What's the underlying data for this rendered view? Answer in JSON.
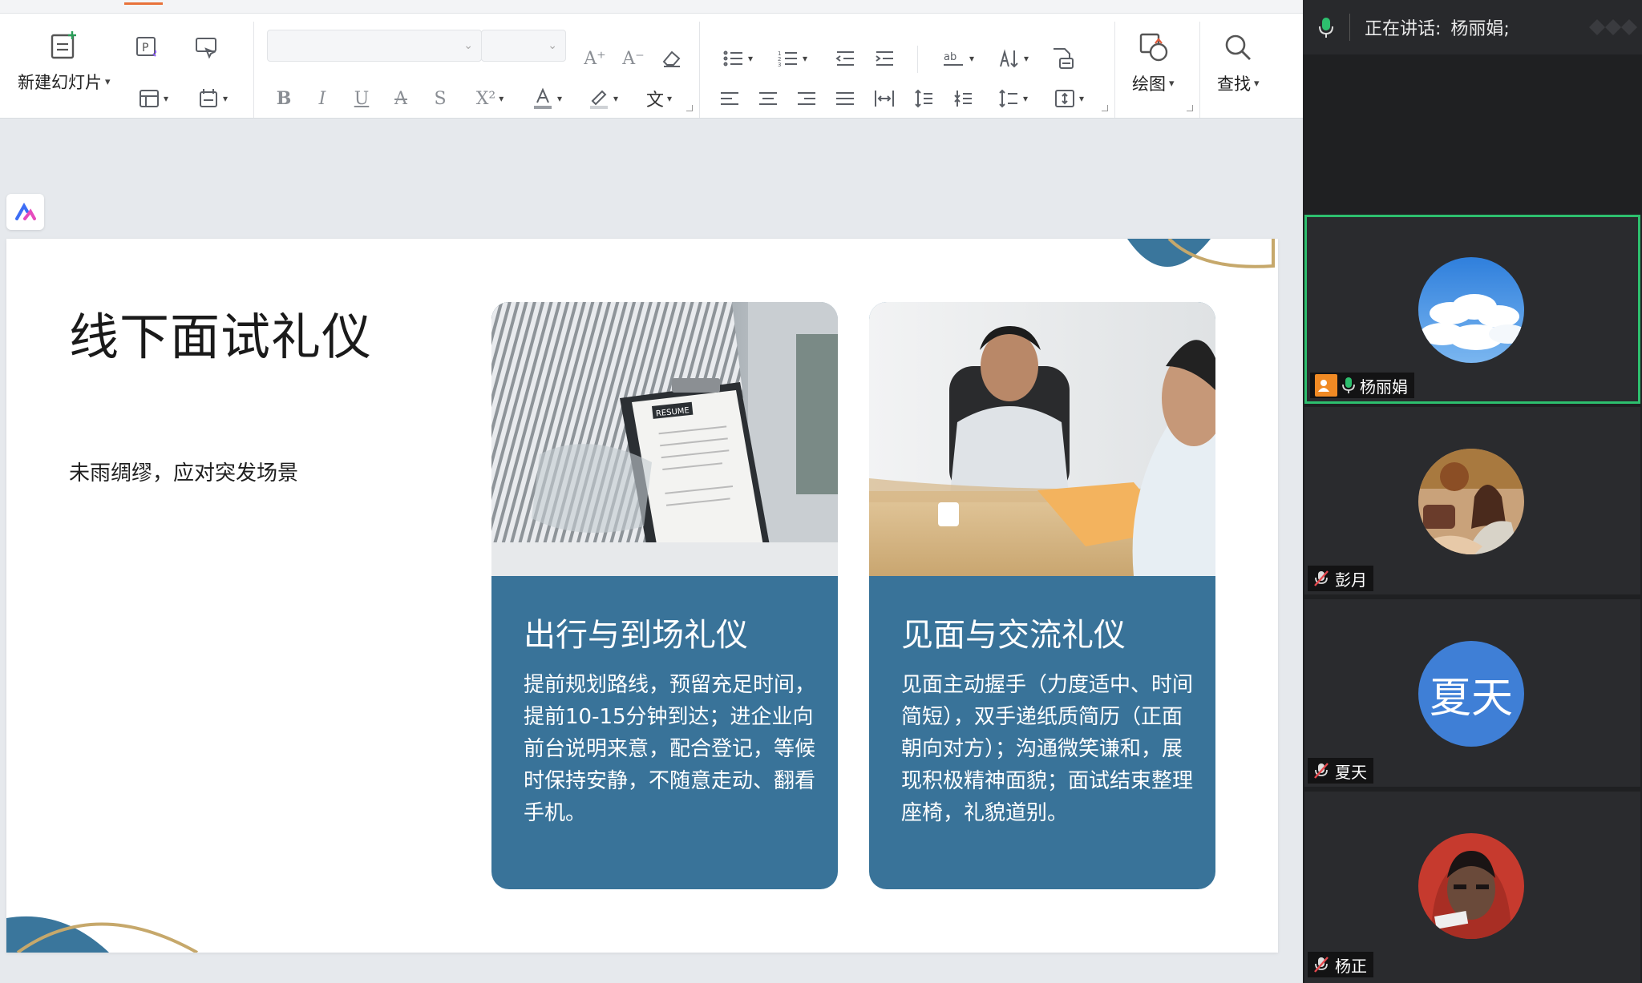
{
  "ribbon": {
    "new_slide_label": "新建幻灯片",
    "draw_label": "绘图",
    "find_label": "查找",
    "font_name_value": "",
    "font_size_value": ""
  },
  "slide": {
    "title": "线下面试礼仪",
    "subtitle": "未雨绸缪，应对突发场景",
    "cards": [
      {
        "title": "出行与到场礼仪",
        "text": "提前规划路线，预留充足时间，提前10-15分钟到达；进企业向前台说明来意，配合登记，等候时保持安静，不随意走动、翻看手机。",
        "photo_label": "RESUME"
      },
      {
        "title": "见面与交流礼仪",
        "text": "见面主动握手（力度适中、时间简短），双手递纸质简历（正面朝向对方）；沟通微笑谦和，展现积极精神面貌；面试结束整理座椅，礼貌道别。"
      }
    ],
    "colors": {
      "card_bg": "#397399",
      "accent_arc": "#c6a86b",
      "accent_blob": "#3a769c"
    }
  },
  "meeting": {
    "speaking_label": "正在讲话:",
    "current_speaker": "杨丽娟;",
    "participants": [
      {
        "name": "杨丽娟",
        "avatar": "sky-clouds",
        "host": true,
        "mic": "on",
        "active": true
      },
      {
        "name": "彭月",
        "avatar": "photo-girl",
        "host": false,
        "mic": "muted",
        "active": false
      },
      {
        "name": "夏天",
        "avatar_text": "夏天",
        "host": false,
        "mic": "muted",
        "active": false
      },
      {
        "name": "杨正",
        "avatar": "photo-boy",
        "host": false,
        "mic": "muted",
        "active": false
      }
    ],
    "colors": {
      "active_border": "#2dbf6e",
      "host_badge": "#f08a24",
      "text_avatar": "#3f7fd6"
    }
  }
}
